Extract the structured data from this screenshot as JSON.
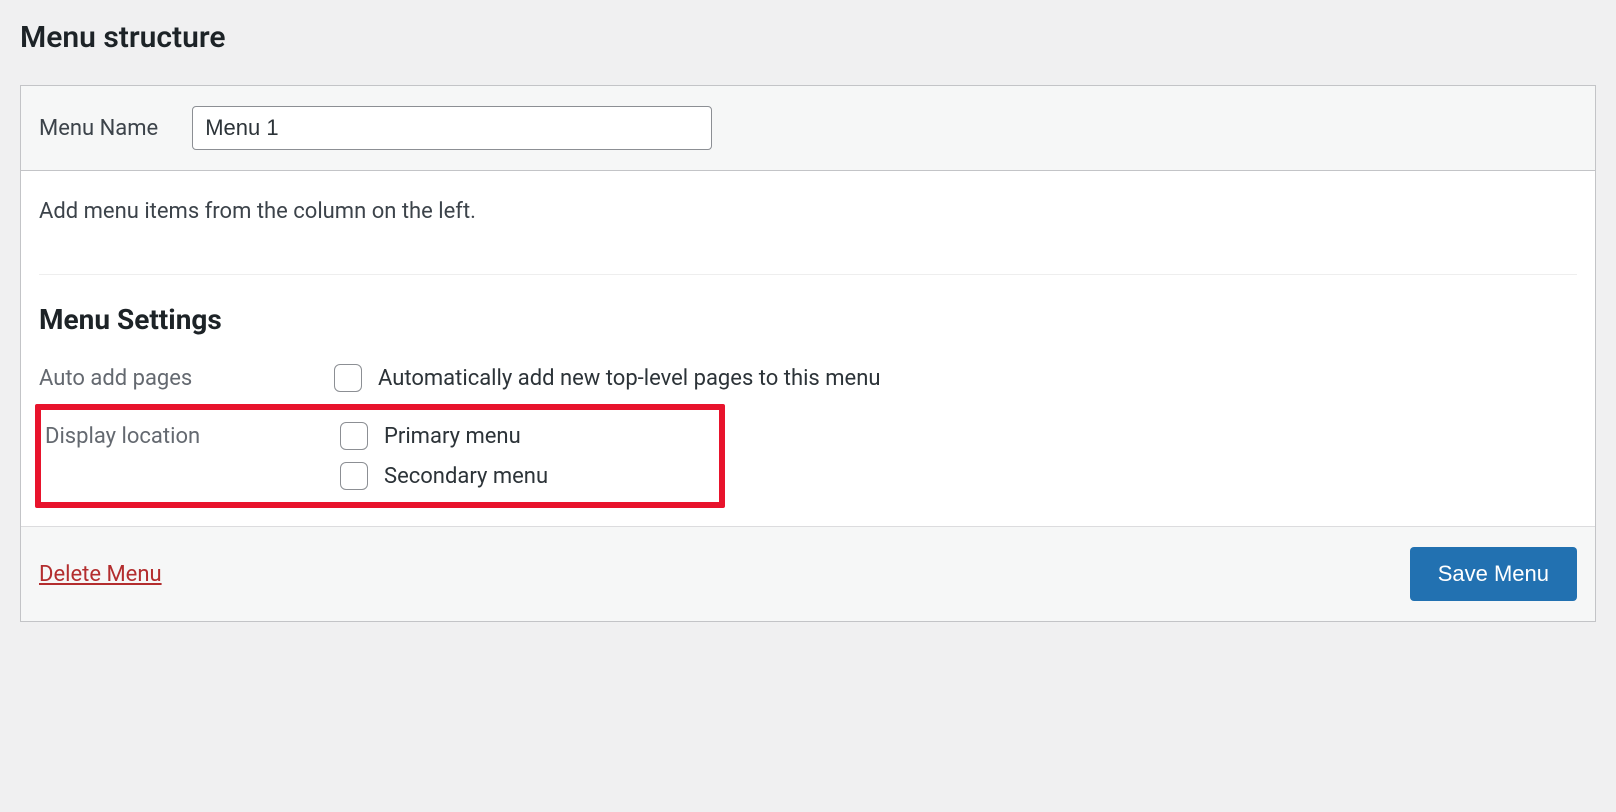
{
  "header": {
    "title": "Menu structure"
  },
  "menuName": {
    "label": "Menu Name",
    "value": "Menu 1"
  },
  "body": {
    "helpText": "Add menu items from the column on the left."
  },
  "settings": {
    "title": "Menu Settings",
    "autoAdd": {
      "label": "Auto add pages",
      "optionLabel": "Automatically add new top-level pages to this menu",
      "checked": false
    },
    "displayLocation": {
      "label": "Display location",
      "options": [
        {
          "label": "Primary menu",
          "checked": false
        },
        {
          "label": "Secondary menu",
          "checked": false
        }
      ]
    }
  },
  "footer": {
    "deleteLabel": "Delete Menu",
    "saveLabel": "Save Menu"
  }
}
